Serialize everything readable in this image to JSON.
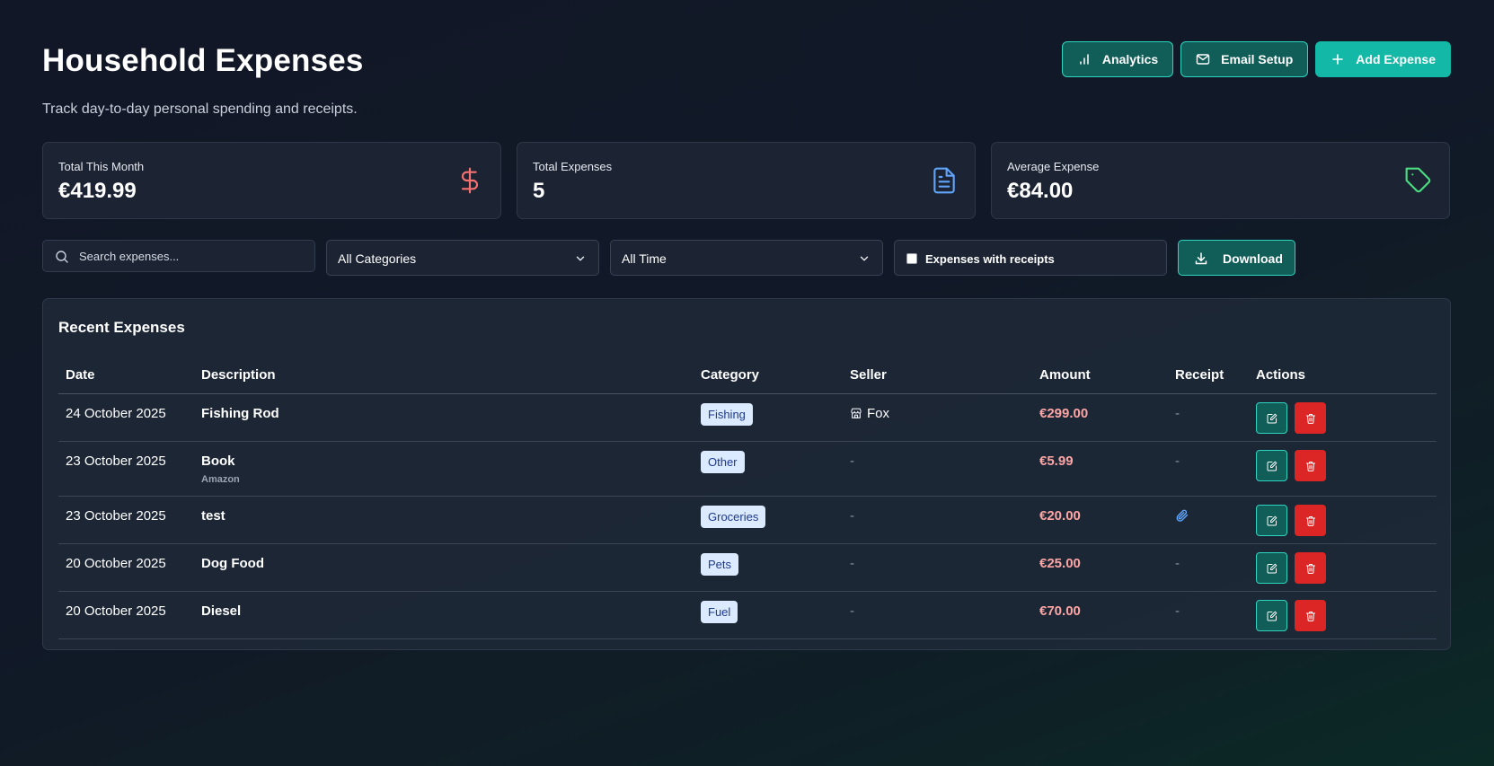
{
  "header": {
    "title": "Household Expenses",
    "subtitle": "Track day-to-day personal spending and receipts.",
    "buttons": {
      "analytics": "Analytics",
      "email_setup": "Email Setup",
      "add_expense": "Add Expense"
    }
  },
  "stats": [
    {
      "label": "Total This Month",
      "value": "€419.99",
      "icon": "dollar-icon",
      "color": "#f87171"
    },
    {
      "label": "Total Expenses",
      "value": "5",
      "icon": "document-icon",
      "color": "#60a5fa"
    },
    {
      "label": "Average Expense",
      "value": "€84.00",
      "icon": "tag-icon",
      "color": "#4ade80"
    }
  ],
  "filters": {
    "search_placeholder": "Search expenses...",
    "category_selected": "All Categories",
    "time_selected": "All Time",
    "receipts_label": "Expenses with receipts",
    "receipts_checked": false,
    "download_label": "Download"
  },
  "table": {
    "title": "Recent Expenses",
    "columns": [
      "Date",
      "Description",
      "Category",
      "Seller",
      "Amount",
      "Receipt",
      "Actions"
    ],
    "rows": [
      {
        "date": "24 October 2025",
        "description": "Fishing Rod",
        "vendor": "",
        "category": "Fishing",
        "seller": "Fox",
        "amount": "€299.00",
        "receipt": "-"
      },
      {
        "date": "23 October 2025",
        "description": "Book",
        "vendor": "Amazon",
        "category": "Other",
        "seller": "-",
        "amount": "€5.99",
        "receipt": "-"
      },
      {
        "date": "23 October 2025",
        "description": "test",
        "vendor": "",
        "category": "Groceries",
        "seller": "-",
        "amount": "€20.00",
        "receipt": "paperclip-icon"
      },
      {
        "date": "20 October 2025",
        "description": "Dog Food",
        "vendor": "",
        "category": "Pets",
        "seller": "-",
        "amount": "€25.00",
        "receipt": "-"
      },
      {
        "date": "20 October 2025",
        "description": "Diesel",
        "vendor": "",
        "category": "Fuel",
        "seller": "-",
        "amount": "€70.00",
        "receipt": "-"
      }
    ]
  },
  "colors": {
    "accent": "#14b8a6",
    "accent_dark": "#115e59",
    "danger": "#dc2626",
    "amount": "#fca5a5",
    "badge_bg": "#dbeafe",
    "badge_text": "#1e3a8a"
  }
}
